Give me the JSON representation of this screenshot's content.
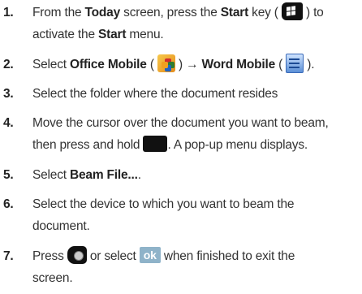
{
  "steps": [
    {
      "num": "1.",
      "a": "From the ",
      "b1": "Today",
      "c": " screen, press the ",
      "b2": "Start",
      "d": " key ( ",
      "e": " ) to",
      "line2a": "activate the ",
      "line2b": "Start",
      "line2c": " menu."
    },
    {
      "num": "2.",
      "a": "Select ",
      "b1": "Office Mobile",
      "c": " ( ",
      "d": " ) → ",
      "b2": "Word Mobile",
      "e": " ( ",
      "f": " )."
    },
    {
      "num": "3.",
      "a": "Select the folder where the document resides"
    },
    {
      "num": "4.",
      "a": "Move the cursor over the document you want to beam,",
      "line2a": "then press and hold ",
      "line2b": ". A pop-up menu displays."
    },
    {
      "num": "5.",
      "a": "Select ",
      "b1": "Beam File...",
      "c": "."
    },
    {
      "num": "6.",
      "a": "Select the device to which you want to beam the",
      "line2a": "document."
    },
    {
      "num": "7.",
      "a": "Press ",
      "b": " or select ",
      "ok": "ok",
      "c": " when finished to exit the",
      "line2a": "screen."
    }
  ],
  "icons": {
    "start_key": "windows-start-key-icon",
    "office": "office-mobile-icon",
    "word": "word-mobile-icon",
    "hold_key": "action-key-icon",
    "end_key": "end-key-icon",
    "ok_key": "ok-softkey-icon"
  }
}
